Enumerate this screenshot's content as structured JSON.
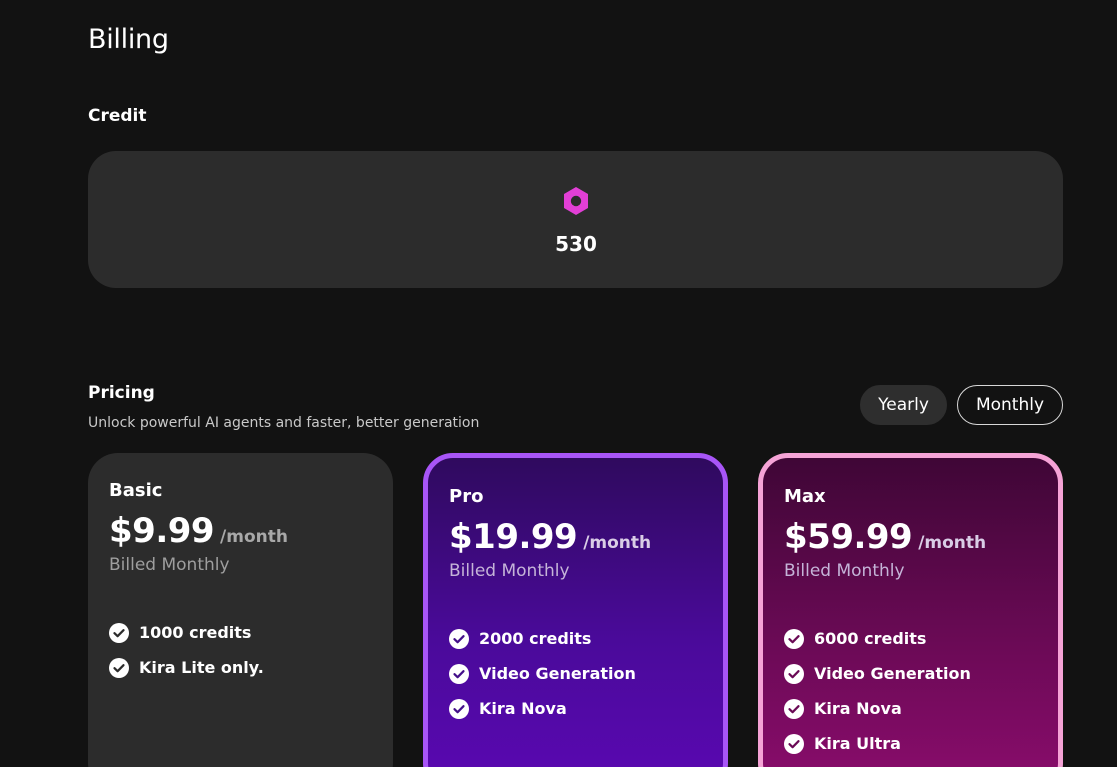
{
  "header": {
    "title": "Billing"
  },
  "credit": {
    "section_title": "Credit",
    "value": "530",
    "icon": "hexagon-nut-icon",
    "icon_color": "#e23fd6"
  },
  "pricing": {
    "section_title": "Pricing",
    "subtitle": "Unlock powerful AI agents and faster, better generation",
    "toggle": {
      "yearly_label": "Yearly",
      "monthly_label": "Monthly",
      "selected": "Monthly"
    },
    "plans": [
      {
        "name": "Basic",
        "price": "$9.99",
        "period": "/month",
        "billing": "Billed Monthly",
        "features": [
          "1000 credits",
          "Kira Lite only."
        ],
        "border_color": "none"
      },
      {
        "name": "Pro",
        "price": "$19.99",
        "period": "/month",
        "billing": "Billed Monthly",
        "features": [
          "2000 credits",
          "Video Generation",
          "Kira Nova"
        ],
        "border_color": "#a855f7"
      },
      {
        "name": "Max",
        "price": "$59.99",
        "period": "/month",
        "billing": "Billed Monthly",
        "features": [
          "6000 credits",
          "Video Generation",
          "Kira Nova",
          "Kira Ultra"
        ],
        "border_color": "#f5a3d6"
      }
    ]
  }
}
